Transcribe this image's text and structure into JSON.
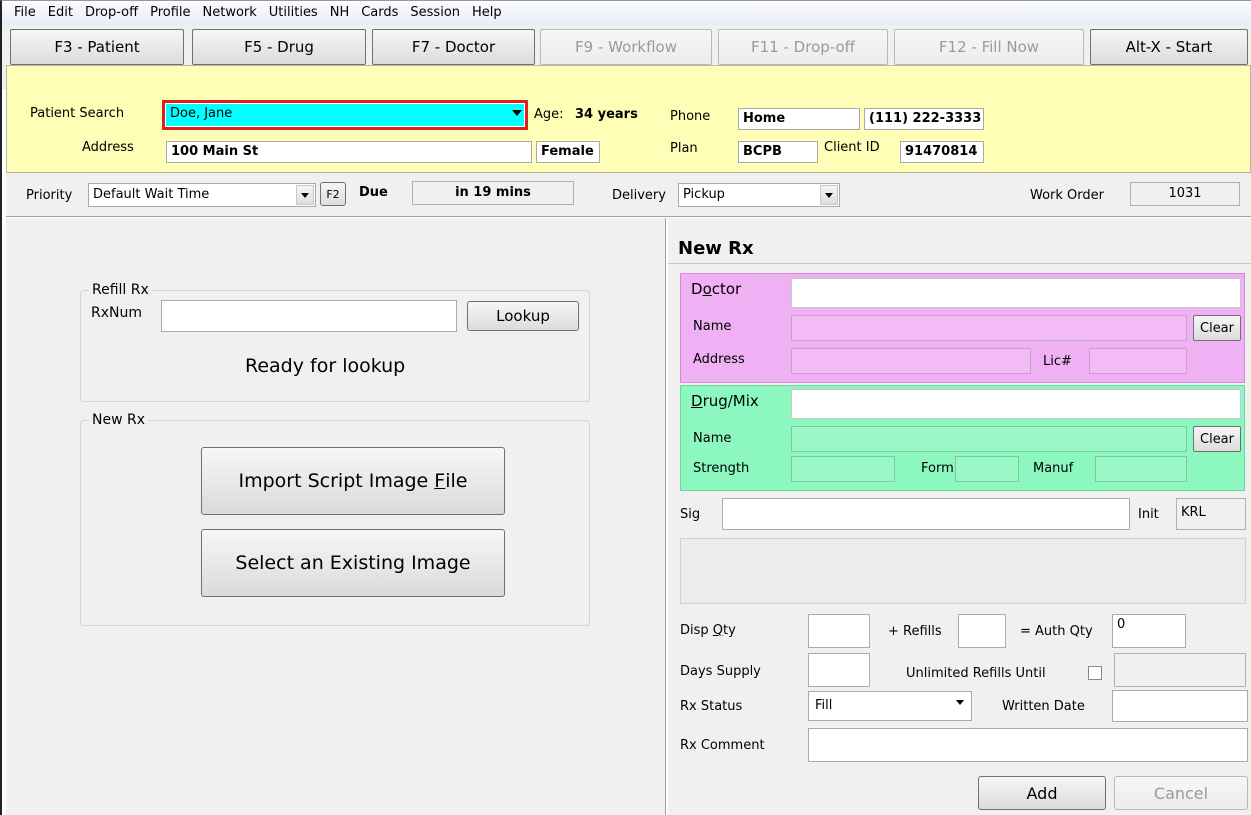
{
  "menu": [
    "File",
    "Edit",
    "Drop-off",
    "Profile",
    "Network",
    "Utilities",
    "NH",
    "Cards",
    "Session",
    "Help"
  ],
  "toolbar": {
    "patient": "F3 - Patient",
    "drug": "F5 - Drug",
    "doctor": "F7 - Doctor",
    "workflow": "F9 - Workflow",
    "dropoff": "F11 - Drop-off",
    "fill_now": "F12 - Fill Now",
    "start": "Alt-X - Start"
  },
  "patient": {
    "search_label": "Patient Search",
    "search_value": "Doe, Jane",
    "age_label": "Age:",
    "age_value": "34 years",
    "address_label": "Address",
    "address_value": "100 Main St",
    "gender": "Female",
    "phone_label": "Phone",
    "phone_type": "Home",
    "phone_value": "(111) 222-3333",
    "plan_label": "Plan",
    "plan_value": "BCPB",
    "client_id_label": "Client ID",
    "client_id_value": "91470814"
  },
  "priority_row": {
    "priority_label": "Priority",
    "priority_value": "Default Wait Time",
    "f2": "F2",
    "due_label": "Due",
    "due_value": "in 19 mins",
    "delivery_label": "Delivery",
    "delivery_value": "Pickup",
    "work_order_label": "Work Order",
    "work_order_value": "1031"
  },
  "refill": {
    "title": "Refill Rx",
    "rxnum_label": "RxNum",
    "rxnum_value": "",
    "lookup": "Lookup",
    "status": "Ready for lookup"
  },
  "new_rx_left": {
    "title": "New Rx",
    "import_pre": "Import Script Image ",
    "import_key": "F",
    "import_post": "ile",
    "select_existing": "Select an Existing Image"
  },
  "new_rx": {
    "title": "New Rx",
    "doctor": {
      "title_pre": "D",
      "title_key": "o",
      "title_post": "ctor",
      "name_label": "Name",
      "address_label": "Address",
      "lic_label": "Lic#",
      "clear": "Clear"
    },
    "drug": {
      "title_key": "D",
      "title_post": "rug/Mix",
      "name_label": "Name",
      "strength_label": "Strength",
      "form_label": "Form",
      "manuf_label": "Manuf",
      "clear": "Clear"
    },
    "sig_label": "Sig",
    "init_label": "Init",
    "init_value": "KRL",
    "disp_qty_pre": "Disp ",
    "disp_qty_key": "Q",
    "disp_qty_post": "ty",
    "refills_label": "+ Refills",
    "auth_qty_label": "= Auth Qty",
    "auth_qty_value": "0",
    "days_supply_label": "Days Supply",
    "unlimited_label": "Unlimited Refills Until",
    "rx_status_label": "Rx Status",
    "rx_status_value": "Fill",
    "written_date_label": "Written Date",
    "rx_comment_label": "Rx Comment",
    "add": "Add",
    "cancel": "Cancel"
  }
}
